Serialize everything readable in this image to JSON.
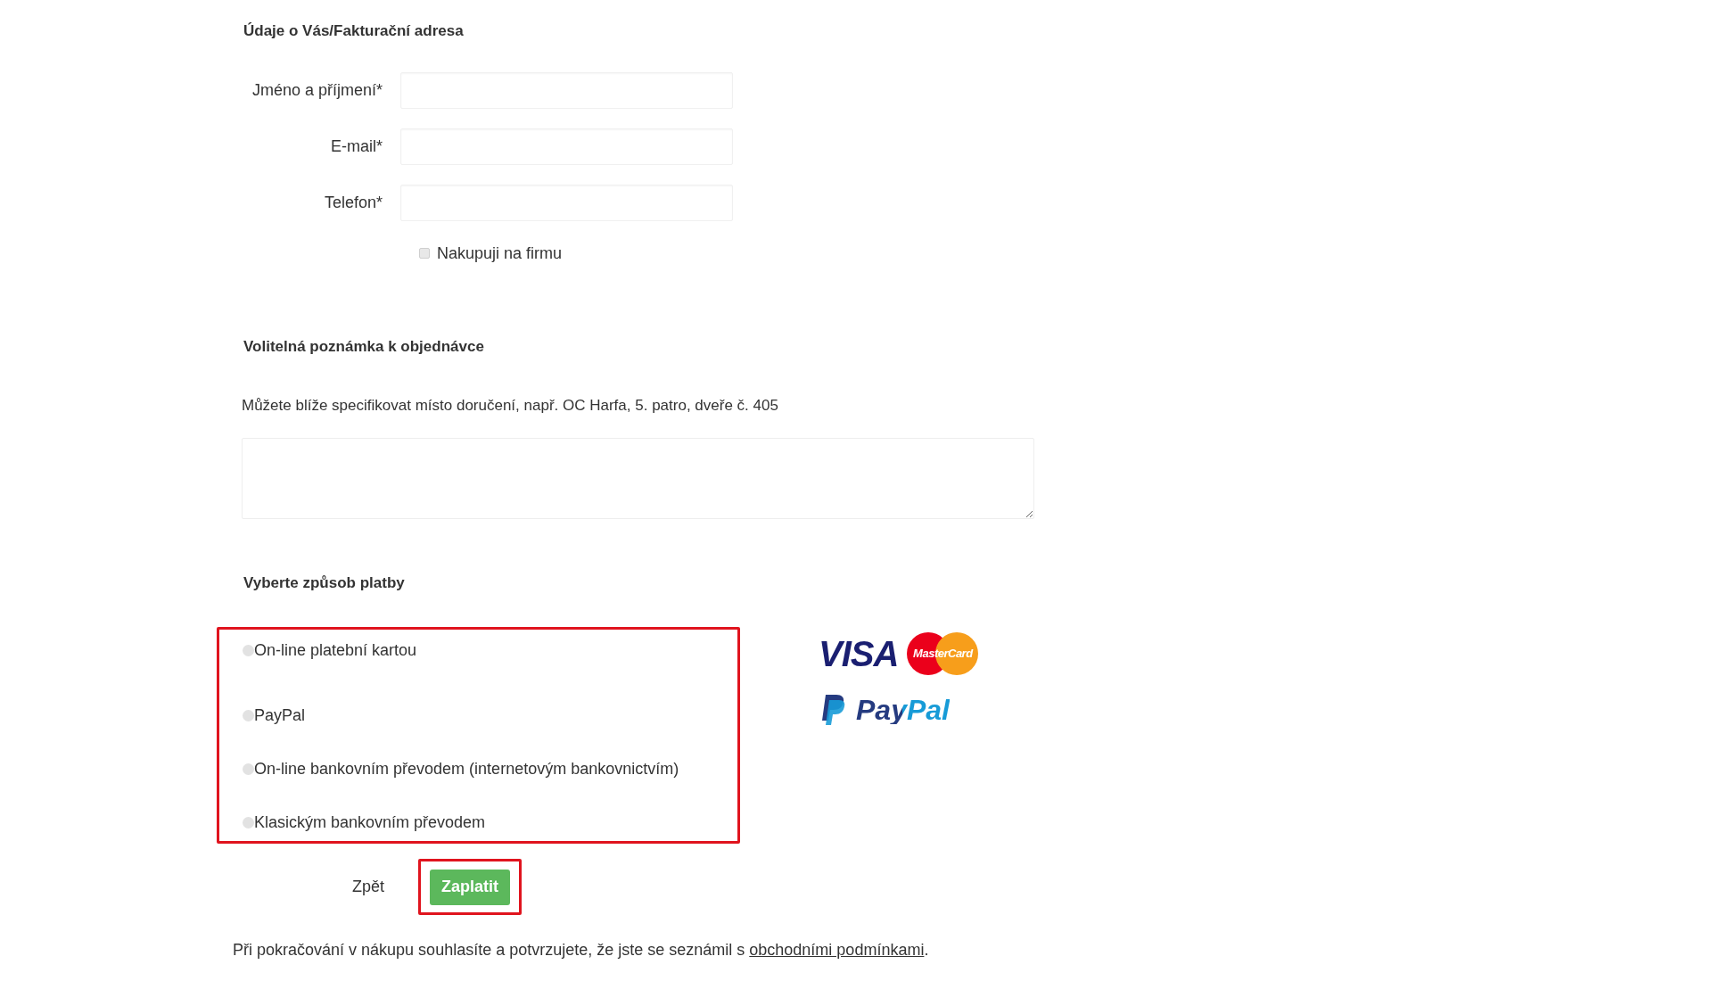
{
  "customer": {
    "title": "Údaje o Vás/Fakturační adresa",
    "fields": [
      {
        "label": "Jméno a příjmení*"
      },
      {
        "label": "E-mail*"
      },
      {
        "label": "Telefon*"
      }
    ],
    "company_checkbox": {
      "label": "Nakupuji na firmu",
      "checked": false
    }
  },
  "note": {
    "title": "Volitelná poznámka k objednávce",
    "hint": "Můžete blíže specifikovat místo doručení, např. OC Harfa, 5. patro, dveře č. 405"
  },
  "payment": {
    "title": "Vyberte způsob platby",
    "options": [
      {
        "label": "On-line platební kartou",
        "selected": false
      },
      {
        "label": "PayPal",
        "selected": false
      },
      {
        "label": "On-line bankovním převodem (internetovým bankovnictvím)",
        "selected": false
      },
      {
        "label": "Klasickým bankovním převodem",
        "selected": false
      }
    ],
    "logos": {
      "visa": "VISA",
      "mastercard": "MasterCard",
      "paypal": "PayPal"
    }
  },
  "actions": {
    "back": "Zpět",
    "pay": "Zaplatit"
  },
  "footer": {
    "text": "Při pokračování v nákupu souhlasíte a potvrzujete, že jste se seznámil s ",
    "link": "obchodními podmínkami",
    "end": "."
  }
}
